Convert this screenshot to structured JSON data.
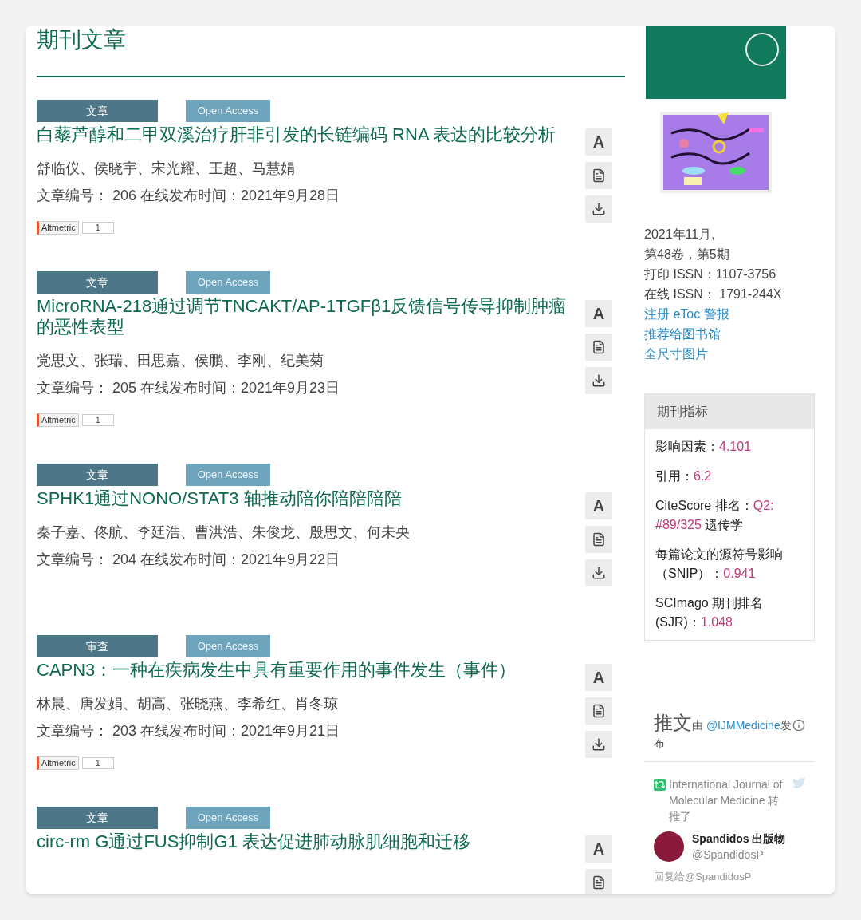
{
  "heading": "期刊文章",
  "articles": [
    {
      "kind_badge": "文章",
      "access_badge": "Open Access",
      "title": "白藜芦醇和二甲双溪治疗肝非引发的长链编码 RNA 表达的比较分析",
      "authors": "舒临仪、侯晓宇、宋光耀、王超、马慧娟",
      "meta": "文章编号： 206 在线发布时间：2021年9月28日",
      "abstract_button": "A",
      "altmetric": {
        "label": "Altmetric",
        "count": "1"
      }
    },
    {
      "kind_badge": "文章",
      "access_badge": "Open Access",
      "title": "MicroRNA-218通过调节TNCAKT/AP-1TGFβ1反馈信号传导抑制肿瘤的恶性表型",
      "authors": "党思文、张瑞、田思嘉、侯鹏、李刚、纪美菊",
      "meta": "文章编号： 205 在线发布时间：2021年9月23日",
      "abstract_button": "A",
      "altmetric": {
        "label": "Altmetric",
        "count": "1"
      }
    },
    {
      "kind_badge": "文章",
      "access_badge": "Open Access",
      "title": "SPHK1通过NONO/STAT3 轴推动陪你陪陪陪陪",
      "authors": "秦子嘉、佟航、李廷浩、曹洪浩、朱俊龙、殷思文、何未央",
      "meta": "文章编号： 204 在线发布时间：2021年9月22日",
      "abstract_button": "A"
    },
    {
      "kind_badge": "审查",
      "access_badge": "Open Access",
      "title": "CAPN3：一种在疾病发生中具有重要作用的事件发生（事件）",
      "authors": "林晨、唐发娟、胡高、张晓燕、李希红、肖冬琼",
      "meta": "文章编号： 203 在线发布时间：2021年9月21日",
      "abstract_button": "A",
      "altmetric": {
        "label": "Altmetric",
        "count": "1"
      }
    },
    {
      "kind_badge": "文章",
      "access_badge": "Open Access",
      "title": "circ-rm G通过FUS抑制G1 表达促进肺动脉肌细胞和迁移",
      "abstract_button": "A"
    }
  ],
  "sidebar": {
    "cover": {
      "kind": "picture"
    },
    "issue_info": [
      "2021年11月,",
      "第48卷，第5期",
      "打印 ISSN：1107-3756",
      "在线 ISSN： 1791-244X"
    ],
    "links": [
      "注册 eToc 警报",
      "推荐给图书馆",
      "全尺寸图片"
    ],
    "metrics": {
      "title": "期刊指标",
      "items": [
        {
          "label": "影响因素：",
          "value": "4.101"
        },
        {
          "label": "引用：",
          "value": "6.2"
        },
        {
          "label": "CiteScore 排名：",
          "value": "Q2: #89/325",
          "suffix": " 遗传学"
        },
        {
          "label": "每篇论文的源符号影响（SNIP）：",
          "value": "0.941"
        },
        {
          "label": "SCImago 期刊排名 (SJR)：",
          "value": "1.048"
        }
      ]
    },
    "tweets": {
      "title": "推文",
      "by": "由",
      "handle": "@IJMMedicine",
      "by_end": "发布",
      "retweet_note": "International Journal of Molecular Medicine 转推了",
      "author_name": "Spandidos 出版物",
      "author_handle": "@SpandidosP",
      "reply_note": "回复给@SpandidosP"
    }
  }
}
